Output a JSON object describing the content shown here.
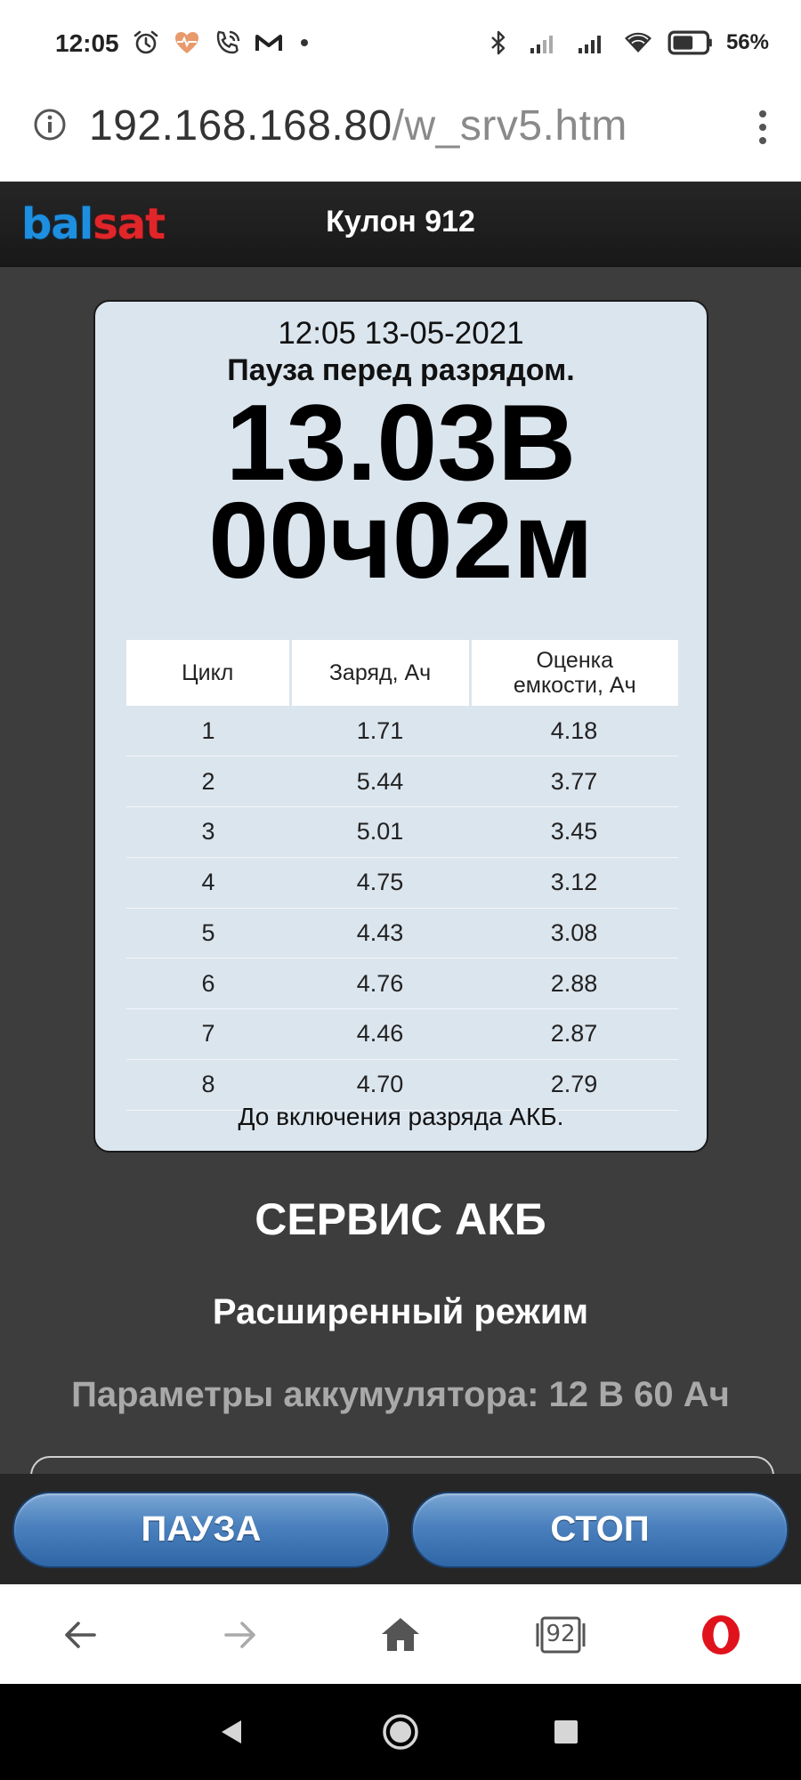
{
  "status_bar": {
    "time": "12:05",
    "battery_percent": "56%",
    "left_icons": [
      "alarm-icon",
      "health-heart-icon",
      "wifi-call-icon",
      "gmail-m-icon",
      "more-dot-icon"
    ],
    "right_icons": [
      "bluetooth-icon",
      "signal-icon",
      "signal-icon",
      "wifi-icon",
      "battery-icon"
    ]
  },
  "address_bar": {
    "url_host": "192.168.168.80",
    "url_path": "/w_srv5.htm"
  },
  "header": {
    "logo_part1": "bal",
    "logo_part2": "sat",
    "title": "Кулон 912"
  },
  "card": {
    "datetime": "12:05 13-05-2021",
    "status": "Пауза перед разрядом.",
    "voltage": "13.03В",
    "timer": "00ч02м",
    "table": {
      "headers": [
        "Цикл",
        "Заряд, Ач",
        "Оценка емкости, Ач"
      ],
      "rows": [
        [
          "1",
          "1.71",
          "4.18"
        ],
        [
          "2",
          "5.44",
          "3.77"
        ],
        [
          "3",
          "5.01",
          "3.45"
        ],
        [
          "4",
          "4.75",
          "3.12"
        ],
        [
          "5",
          "4.43",
          "3.08"
        ],
        [
          "6",
          "4.76",
          "2.88"
        ],
        [
          "7",
          "4.46",
          "2.87"
        ],
        [
          "8",
          "4.70",
          "2.79"
        ]
      ]
    },
    "footnote": "До включения разряда АКБ."
  },
  "section": {
    "title": "СЕРВИС АКБ",
    "mode": "Расширенный режим",
    "battery_params": "Параметры аккумулятора: 12 В 60 Ач"
  },
  "buttons": {
    "pause": "ПАУЗА",
    "stop": "СТОП"
  },
  "browser_nav": {
    "tabs_count": "92"
  },
  "colors": {
    "page_background": "#3d3d3d",
    "card_background": "#dbe5ee",
    "button_blue": "#4a80bd",
    "logo_blue": "#1e8fe0",
    "logo_red": "#e0262a",
    "opera_red": "#e0121b"
  }
}
